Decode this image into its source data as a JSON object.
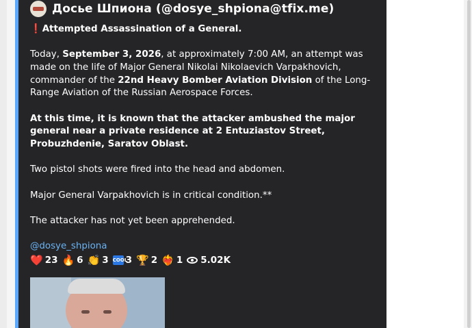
{
  "channel": {
    "name": "Досье Шпиона (@dosye_shpiona@tfix.me)"
  },
  "post": {
    "title_icon": "❗",
    "title": "Attempted Assassination of a General.",
    "p1_a": "Today, ",
    "p1_date": "September 3, 2026",
    "p1_b": ", at approximately 7:00 AM, an attempt was made on the life of Major General Nikolai Nikolaevich Varpakhovich, commander of the ",
    "p1_unit": "22nd Heavy Bomber Aviation Division",
    "p1_c": " of the Long-Range Aviation of the Russian Aerospace Forces.",
    "p2": "At this time, it is known that the attacker ambushed the major general near a private residence at 2 Entuziastov Street, Probuzhdenie, Saratov Oblast.",
    "p3": "Two pistol shots were fired into the head and abdomen.",
    "p4": "Major General Varpakhovich is in critical condition.**",
    "p5": "The attacker has not yet been apprehended.",
    "link": "@dosye_shpiona"
  },
  "reactions": [
    {
      "icon": "❤️",
      "icon_name": "red-heart-icon",
      "count": "23"
    },
    {
      "icon": "🔥",
      "icon_name": "fire-icon",
      "count": "6"
    },
    {
      "icon": "👏",
      "icon_name": "clapping-hands-icon",
      "count": "3"
    },
    {
      "icon": "COOL",
      "icon_name": "cool-icon",
      "count": "3"
    },
    {
      "icon": "🏆",
      "icon_name": "trophy-icon",
      "count": "2"
    },
    {
      "icon": "❤️‍🔥",
      "icon_name": "heart-on-fire-icon",
      "count": "1"
    }
  ],
  "views": {
    "icon_name": "eye-icon",
    "count": "5.02K"
  },
  "colors": {
    "card_bg": "#252528",
    "quote_bar": "#5aa9ff",
    "link": "#6ab3f3",
    "alert_red": "#e0303a"
  }
}
